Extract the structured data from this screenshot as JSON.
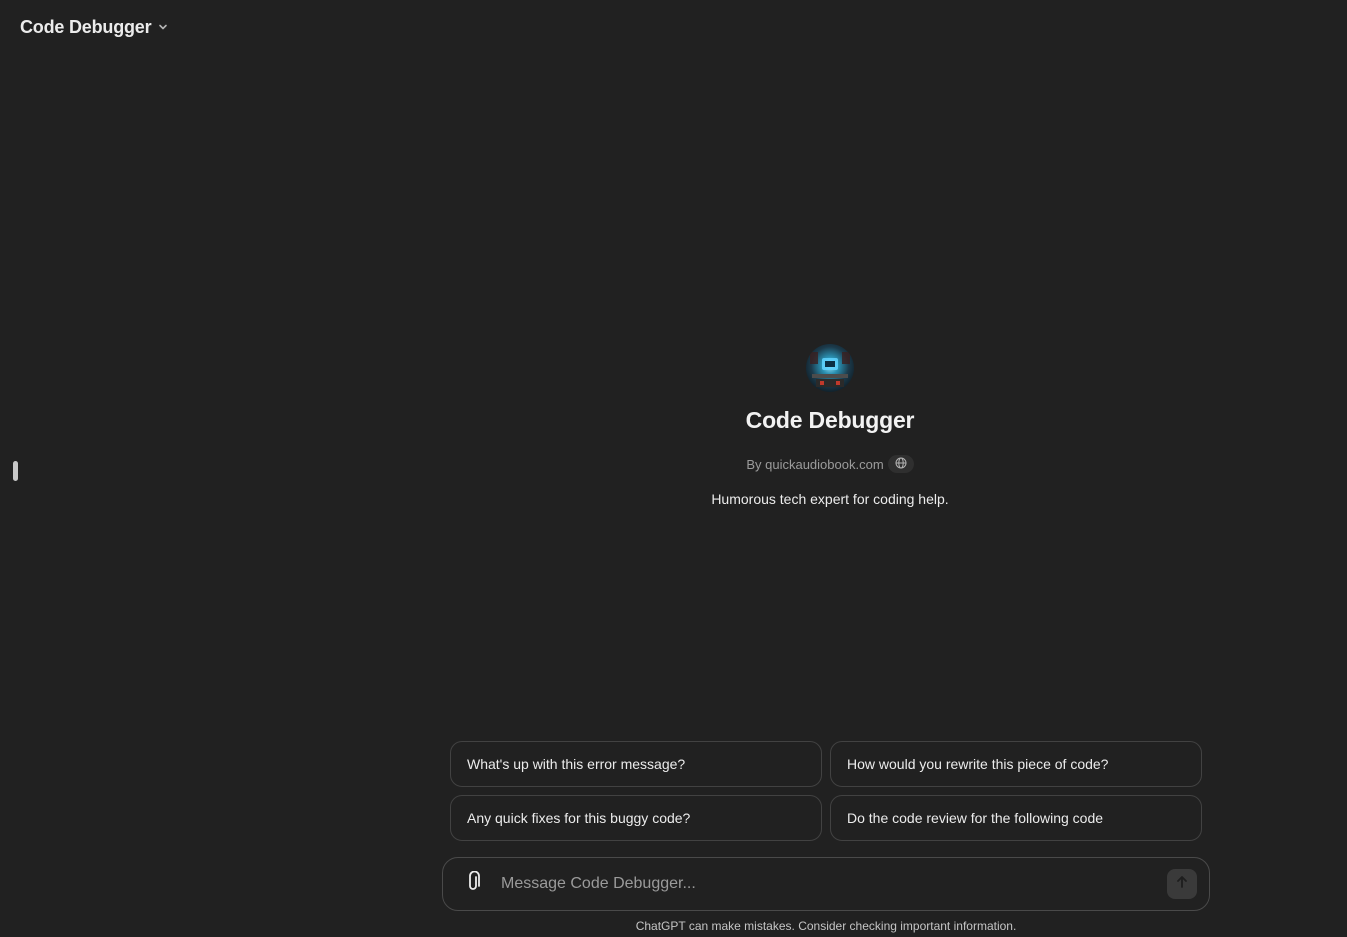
{
  "header": {
    "title": "Code Debugger"
  },
  "gpt": {
    "name": "Code Debugger",
    "author": "By quickaudiobook.com",
    "description": "Humorous tech expert for coding help."
  },
  "starters": [
    "What's up with this error message?",
    "How would you rewrite this piece of code?",
    "Any quick fixes for this buggy code?",
    "Do the code review for the following code"
  ],
  "composer": {
    "placeholder": "Message Code Debugger..."
  },
  "footer": {
    "disclaimer": "ChatGPT can make mistakes. Consider checking important information."
  },
  "icons": {
    "model_selector": "chevron-down-icon",
    "author_link": "globe-icon",
    "attach": "paperclip-icon",
    "send": "arrow-up-icon"
  },
  "colors": {
    "background": "#212121",
    "text": "#ececec",
    "muted_text": "#9b9b9b",
    "border": "#424242"
  }
}
